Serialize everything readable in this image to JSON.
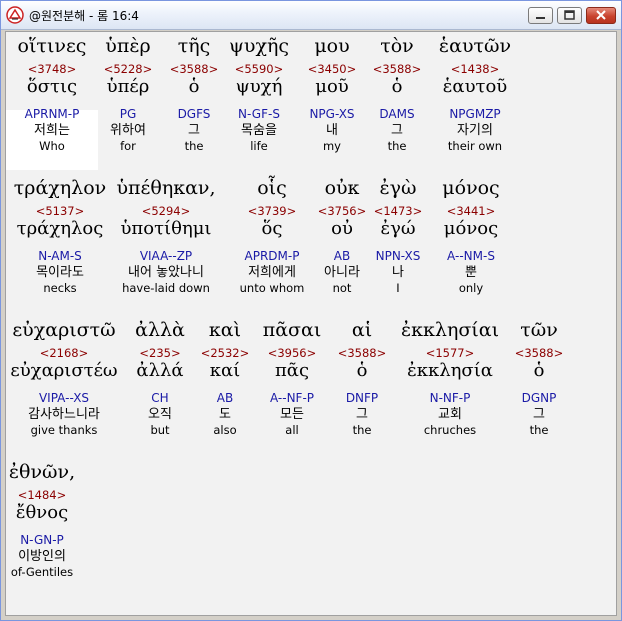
{
  "window": {
    "title": "@원전분해 - 롬 16:4"
  },
  "words": [
    {
      "greek": "οἵτινες",
      "strong": "<3748>",
      "lemma": "ὅστις",
      "parse": "APRNM-P",
      "korean": "저희는",
      "english": "Who"
    },
    {
      "greek": "ὑπὲρ",
      "strong": "<5228>",
      "lemma": "ὑπέρ",
      "parse": "PG",
      "korean": "위하여",
      "english": "for"
    },
    {
      "greek": "τῆς",
      "strong": "<3588>",
      "lemma": "ὁ",
      "parse": "DGFS",
      "korean": "그",
      "english": "the"
    },
    {
      "greek": "ψυχῆς",
      "strong": "<5590>",
      "lemma": "ψυχή",
      "parse": "N-GF-S",
      "korean": "목숨을",
      "english": "life"
    },
    {
      "greek": "μου",
      "strong": "<3450>",
      "lemma": "μοῦ",
      "parse": "NPG-XS",
      "korean": "내",
      "english": "my"
    },
    {
      "greek": "τὸν",
      "strong": "<3588>",
      "lemma": "ὁ",
      "parse": "DAMS",
      "korean": "그",
      "english": "the"
    },
    {
      "greek": "ἑαυτῶν",
      "strong": "<1438>",
      "lemma": "ἑαυτοῦ",
      "parse": "NPGMZP",
      "korean": "자기의",
      "english": "their own"
    },
    {
      "greek": "τράχηλον",
      "strong": "<5137>",
      "lemma": "τράχηλος",
      "parse": "N-AM-S",
      "korean": "목이라도",
      "english": "necks"
    },
    {
      "greek": "ὑπέθηκαν,",
      "strong": "<5294>",
      "lemma": "ὑποτίθημι",
      "parse": "VIAA--ZP",
      "korean": "내어 놓았나니",
      "english": "have-laid down"
    },
    {
      "greek": "οἷς",
      "strong": "<3739>",
      "lemma": "ὅς",
      "parse": "APRDM-P",
      "korean": "저희에게",
      "english": "unto whom"
    },
    {
      "greek": "οὐκ",
      "strong": "<3756>",
      "lemma": "οὐ",
      "parse": "AB",
      "korean": "아니라",
      "english": "not"
    },
    {
      "greek": "ἐγὼ",
      "strong": "<1473>",
      "lemma": "ἐγώ",
      "parse": "NPN-XS",
      "korean": "나",
      "english": "I"
    },
    {
      "greek": "μόνος",
      "strong": "<3441>",
      "lemma": "μόνος",
      "parse": "A--NM-S",
      "korean": "뿐",
      "english": "only"
    },
    {
      "greek": "εὐχαριστῶ",
      "strong": "<2168>",
      "lemma": "εὐχαριστέω",
      "parse": "VIPA--XS",
      "korean": "감사하느니라",
      "english": "give thanks"
    },
    {
      "greek": "ἀλλὰ",
      "strong": "<235>",
      "lemma": "ἀλλά",
      "parse": "CH",
      "korean": "오직",
      "english": "but"
    },
    {
      "greek": "καὶ",
      "strong": "<2532>",
      "lemma": "καί",
      "parse": "AB",
      "korean": "도",
      "english": "also"
    },
    {
      "greek": "πᾶσαι",
      "strong": "<3956>",
      "lemma": "πᾶς",
      "parse": "A--NF-P",
      "korean": "모든",
      "english": "all"
    },
    {
      "greek": "αἱ",
      "strong": "<3588>",
      "lemma": "ὁ",
      "parse": "DNFP",
      "korean": "그",
      "english": "the"
    },
    {
      "greek": "ἐκκλησίαι",
      "strong": "<1577>",
      "lemma": "ἐκκλησία",
      "parse": "N-NF-P",
      "korean": "교회",
      "english": "chruches"
    },
    {
      "greek": "τῶν",
      "strong": "<3588>",
      "lemma": "ὁ",
      "parse": "DGNP",
      "korean": "그",
      "english": "the"
    },
    {
      "greek": "ἐθνῶν,",
      "strong": "<1484>",
      "lemma": "ἔθνος",
      "parse": "N-GN-P",
      "korean": "이방인의",
      "english": "of-Gentiles"
    }
  ]
}
